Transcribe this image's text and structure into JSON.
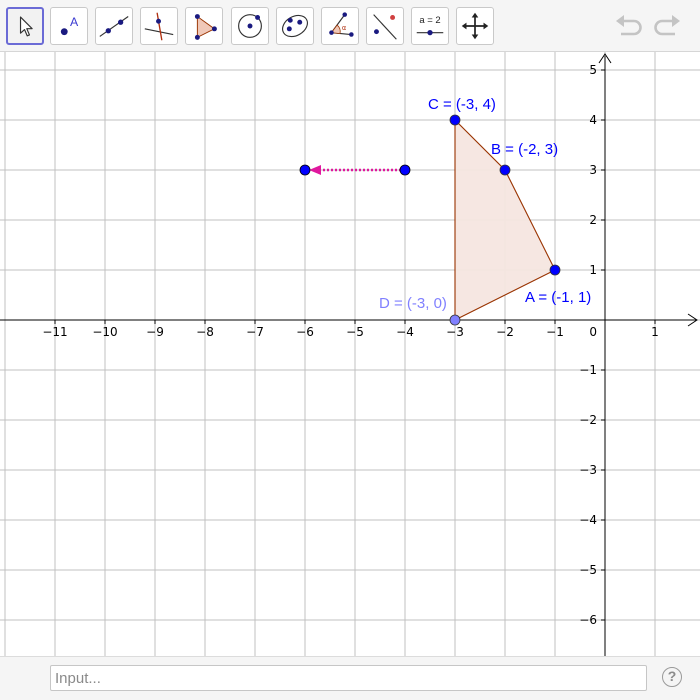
{
  "toolbar": {
    "tools": [
      {
        "name": "move-tool-icon",
        "label": ""
      },
      {
        "name": "point-tool-icon",
        "label": "A"
      },
      {
        "name": "line-tool-icon",
        "label": ""
      },
      {
        "name": "perpendicular-line-tool-icon",
        "label": ""
      },
      {
        "name": "polygon-tool-icon",
        "label": ""
      },
      {
        "name": "circle-tool-icon",
        "label": ""
      },
      {
        "name": "conic-tool-icon",
        "label": ""
      },
      {
        "name": "angle-tool-icon",
        "label": ""
      },
      {
        "name": "reflect-tool-icon",
        "label": ""
      },
      {
        "name": "slider-tool-icon",
        "label": "a = 2"
      },
      {
        "name": "move-graphics-view-tool-icon",
        "label": ""
      }
    ],
    "undo_icon": "undo-icon",
    "redo_icon": "redo-icon"
  },
  "graph": {
    "x_ticks": [
      "−11",
      "−10",
      "−9",
      "−8",
      "−7",
      "−6",
      "−5",
      "−4",
      "−3",
      "−2",
      "−1",
      "0",
      "1"
    ],
    "y_ticks_pos": [
      "1",
      "2",
      "3",
      "4",
      "5"
    ],
    "y_ticks_neg": [
      "−1",
      "−2",
      "−3",
      "−4",
      "−5",
      "−6"
    ],
    "origin_label": "0",
    "points": {
      "A": {
        "label": "A = (-1, 1)",
        "x": -1,
        "y": 1
      },
      "B": {
        "label": "B = (-2, 3)",
        "x": -2,
        "y": 3
      },
      "C": {
        "label": "C = (-3, 4)",
        "x": -3,
        "y": 4
      },
      "D": {
        "label": "D = (-3, 0)",
        "x": -3,
        "y": 0
      }
    },
    "vector": {
      "from": [
        -4,
        3
      ],
      "to": [
        -6,
        3
      ]
    },
    "colors": {
      "point": "#0000ff",
      "point_d": "#8080ff",
      "label": "#0000ff",
      "label_d": "#8080ff",
      "polygon_fill": "#f5e6e0",
      "polygon_edge": "#993300",
      "vector": "#e0189e",
      "grid": "#c0c0c0",
      "axis": "#000000"
    }
  },
  "input": {
    "placeholder": "Input..."
  },
  "help": {
    "label": "?"
  }
}
